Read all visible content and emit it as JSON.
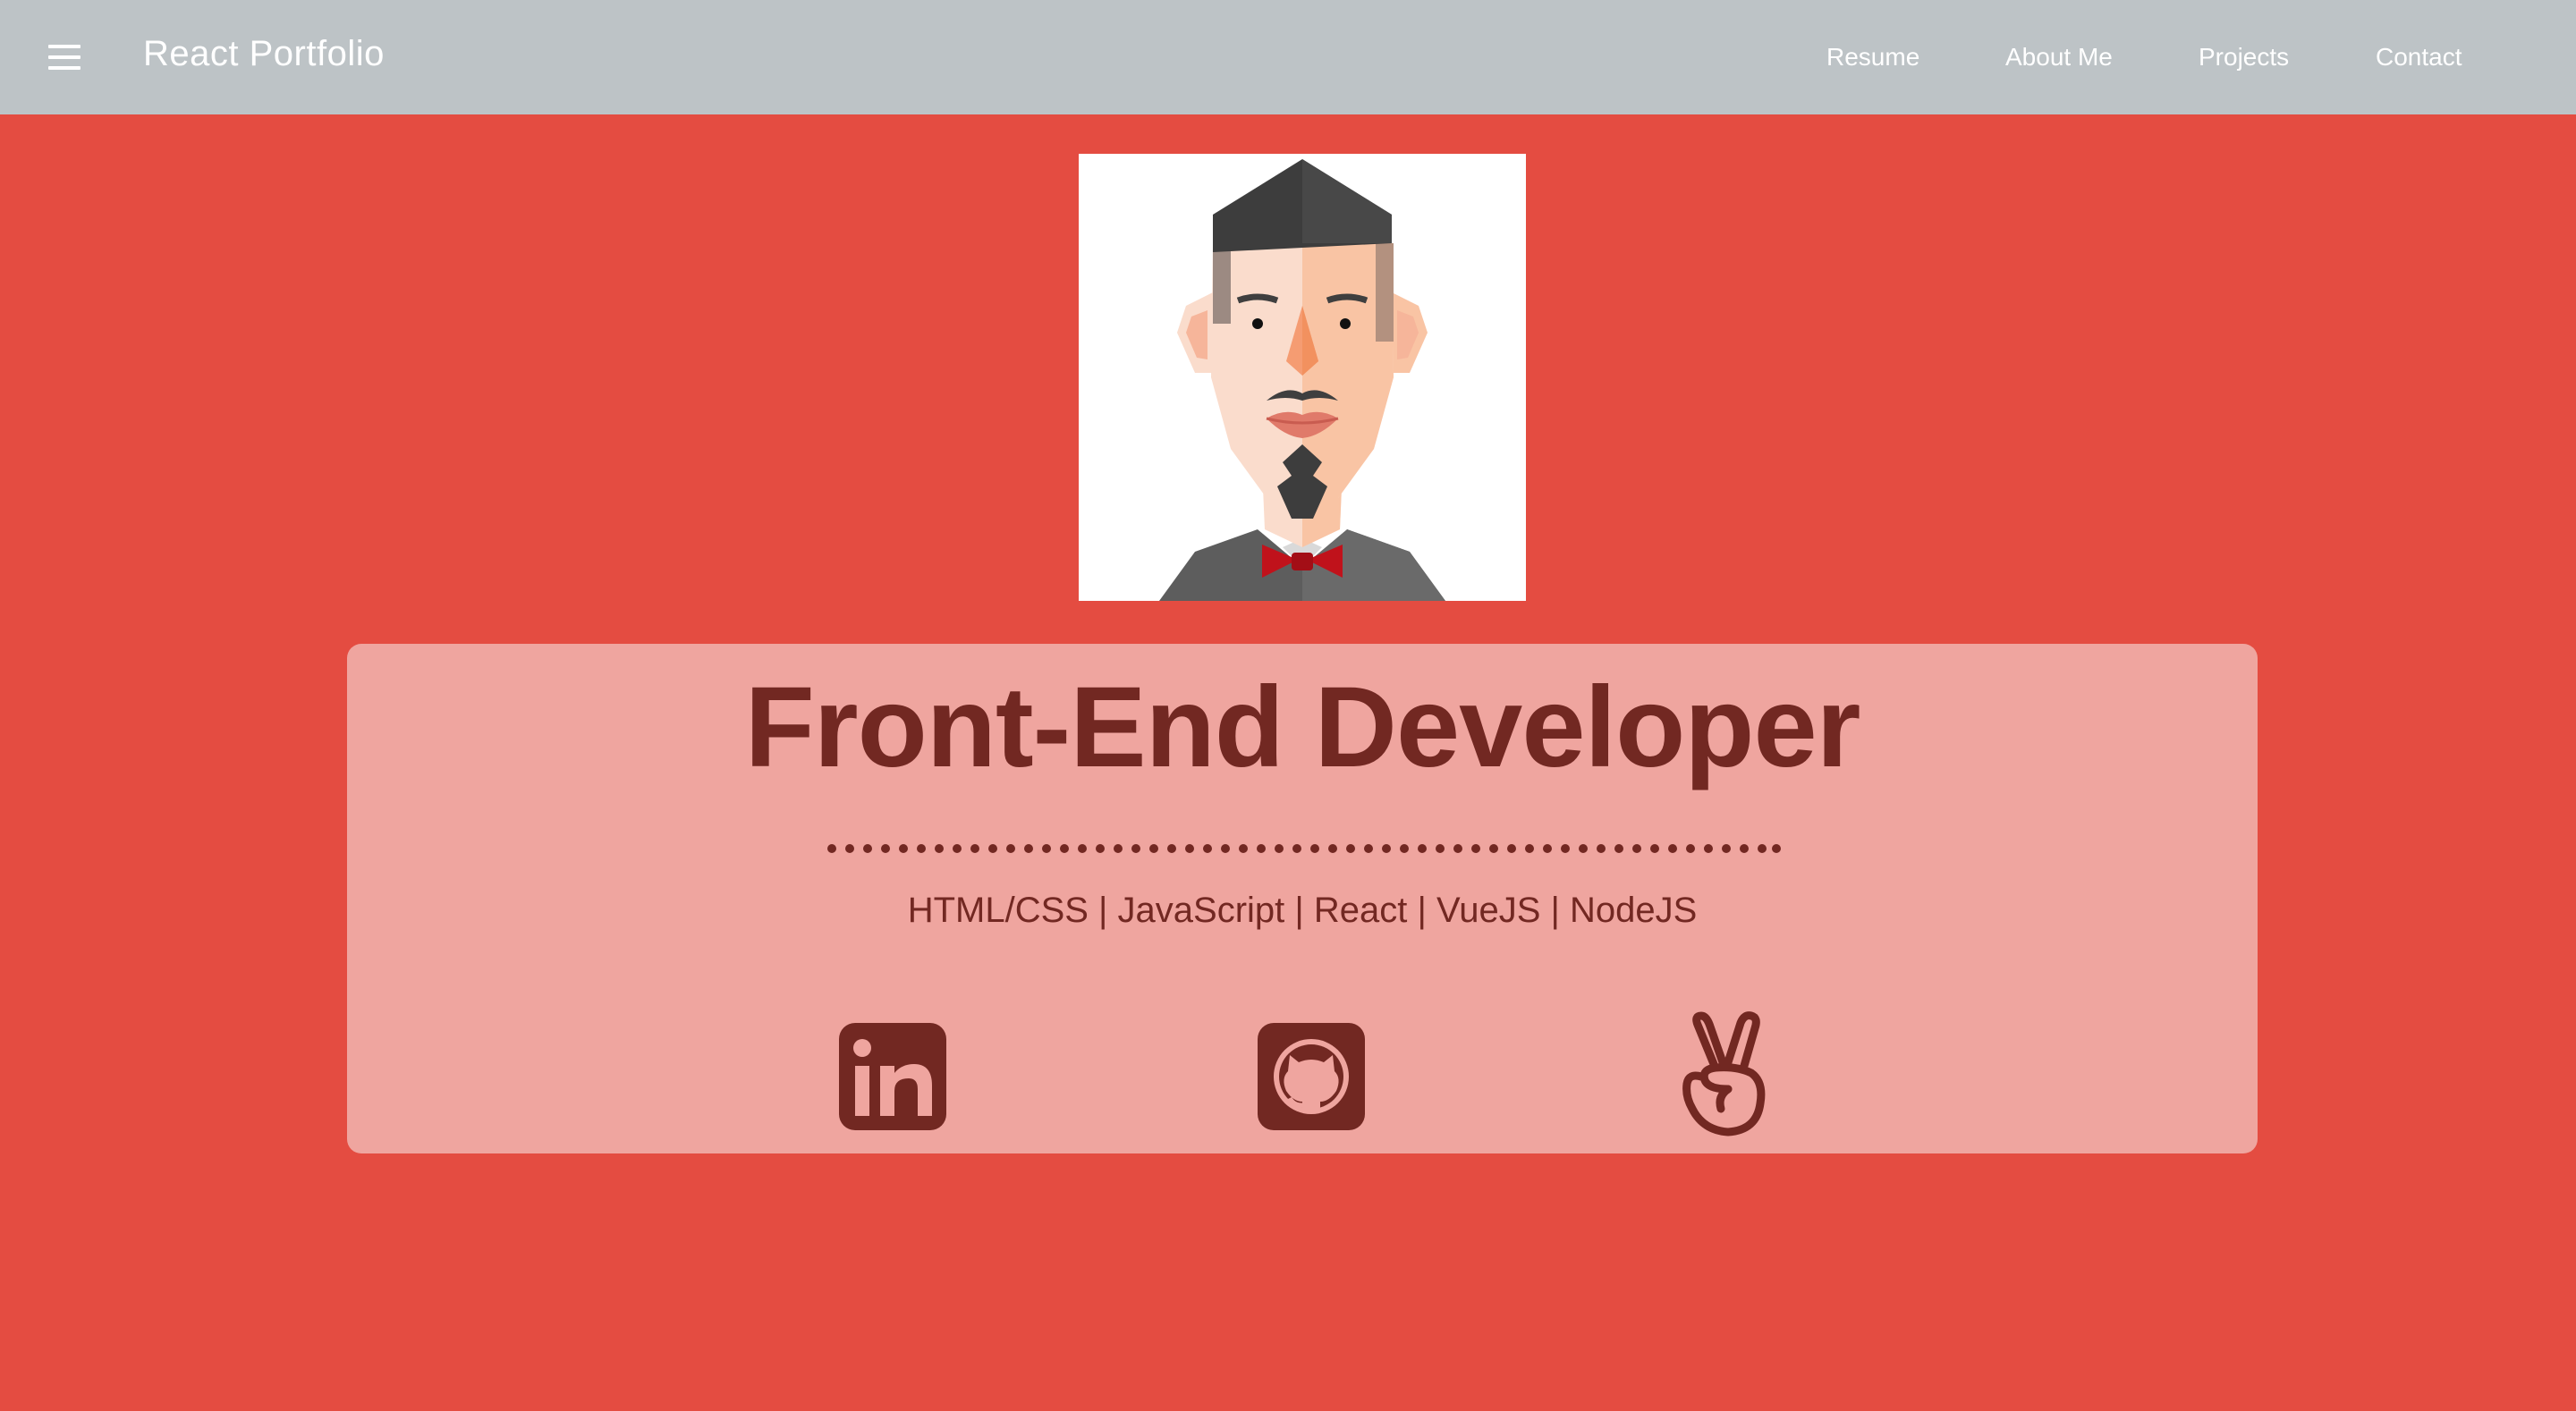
{
  "header": {
    "brand": "React Portfolio",
    "nav": [
      "Resume",
      "About Me",
      "Projects",
      "Contact"
    ]
  },
  "hero": {
    "title": "Front-End Developer",
    "skills": "HTML/CSS | JavaScript | React | VueJS | NodeJS"
  },
  "social": [
    "linkedin-icon",
    "github-icon",
    "angellist-icon"
  ],
  "colors": {
    "background": "#e44c41",
    "topbar": "#bdc3c6",
    "card": "#efa59f",
    "text_dark": "#722822"
  }
}
